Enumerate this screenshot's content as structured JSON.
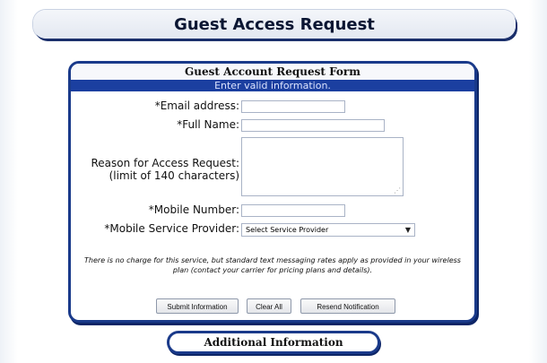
{
  "page": {
    "title": "Guest Access Request"
  },
  "form": {
    "title": "Guest Account Request Form",
    "subtitle": "Enter valid information.",
    "fields": {
      "email_label": "*Email address:",
      "fullname_label": "*Full Name:",
      "reason_label": "Reason for Access Request:",
      "reason_hint": "(limit of 140 characters)",
      "mobile_label": "*Mobile Number:",
      "provider_label": "*Mobile Service Provider:",
      "provider_selected": "Select Service Provider"
    },
    "note": "There is no charge for this service, but standard text messaging rates apply as provided in your wireless plan (contact your carrier for pricing plans and details).",
    "buttons": {
      "submit": "Submit Information",
      "clear": "Clear All",
      "resend": "Resend Notification"
    }
  },
  "additional": {
    "label": "Additional Information"
  },
  "colors": {
    "accent": "#1a3a8a",
    "header_bar": "#1b3fa0"
  }
}
